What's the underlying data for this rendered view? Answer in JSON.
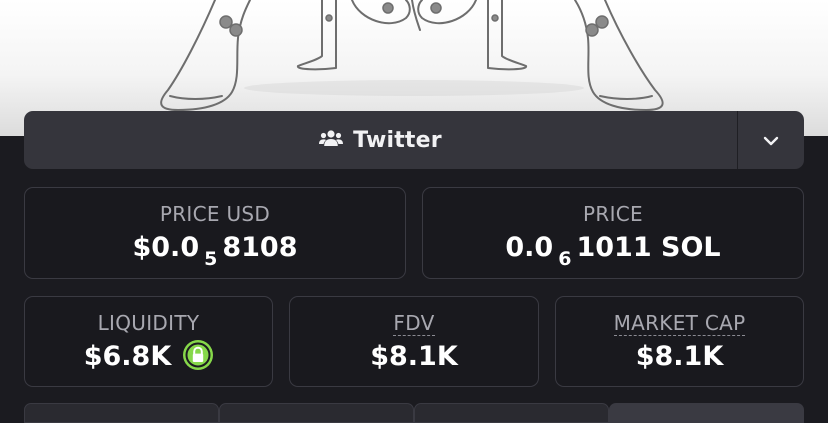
{
  "social": {
    "label": "Twitter",
    "icon": "users-icon",
    "toggle_icon": "chevron-down-icon"
  },
  "stats": {
    "price_usd": {
      "title": "PRICE USD",
      "prefix": "$0.0",
      "zeros": "5",
      "digits": "8108"
    },
    "price": {
      "title": "PRICE",
      "prefix": "0.0",
      "zeros": "6",
      "digits": "1011 SOL"
    },
    "liquidity": {
      "title": "LIQUIDITY",
      "value": "$6.8K",
      "icon": "lock-icon"
    },
    "fdv": {
      "title": "FDV",
      "value": "$8.1K"
    },
    "market_cap": {
      "title": "MARKET CAP",
      "value": "$8.1K"
    }
  },
  "colors": {
    "background": "#1b1b20",
    "card_border": "#3a3a42",
    "bar": "#35353c",
    "lock_badge": "#86d84a",
    "label": "#a8a8b0"
  }
}
